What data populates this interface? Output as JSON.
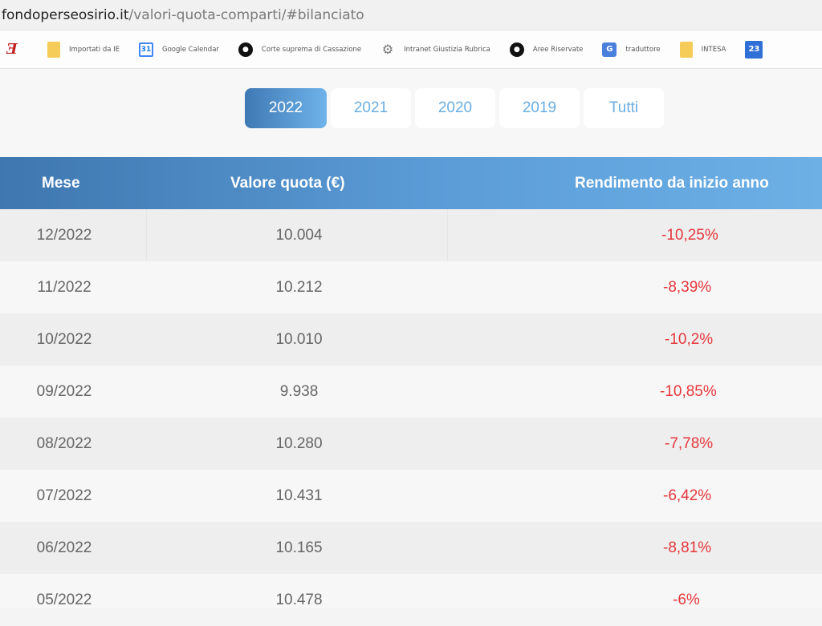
{
  "browser": {
    "url_domain": "fondoperseosirio.it",
    "url_path": "/valori-quota-comparti/#bilanciato",
    "bookmarks": [
      {
        "icon": "logo-icon",
        "label": ""
      },
      {
        "icon": "folder-icon",
        "label": "Importati da IE"
      },
      {
        "icon": "google-calendar-icon",
        "label": "Google Calendar"
      },
      {
        "icon": "globe-icon",
        "label": "Corte suprema di Cassazione"
      },
      {
        "icon": "gear-icon",
        "label": "Intranet Giustizia Rubrica"
      },
      {
        "icon": "globe-icon",
        "label": "Aree Riservate"
      },
      {
        "icon": "translate-icon",
        "label": "traduttore"
      },
      {
        "icon": "folder-icon",
        "label": "INTESA"
      },
      {
        "icon": "calendar-23-icon",
        "label": ""
      }
    ]
  },
  "tabs": [
    {
      "label": "2022",
      "active": true
    },
    {
      "label": "2021",
      "active": false
    },
    {
      "label": "2020",
      "active": false
    },
    {
      "label": "2019",
      "active": false
    },
    {
      "label": "Tutti",
      "active": false
    }
  ],
  "table": {
    "headers": [
      "Mese",
      "Valore quota (€)",
      "Rendimento da inizio anno"
    ],
    "rows": [
      [
        "12/2022",
        "10.004",
        "-10,25%"
      ],
      [
        "11/2022",
        "10.212",
        "-8,39%"
      ],
      [
        "10/2022",
        "10.010",
        "-10,2%"
      ],
      [
        "09/2022",
        "9.938",
        "-10,85%"
      ],
      [
        "08/2022",
        "10.280",
        "-7,78%"
      ],
      [
        "07/2022",
        "10.431",
        "-6,42%"
      ],
      [
        "06/2022",
        "10.165",
        "-8,81%"
      ],
      [
        "05/2022",
        "10.478",
        "-6%"
      ]
    ]
  },
  "colors": {
    "accent": "#4a8ac8",
    "negative": "#e5373d"
  }
}
